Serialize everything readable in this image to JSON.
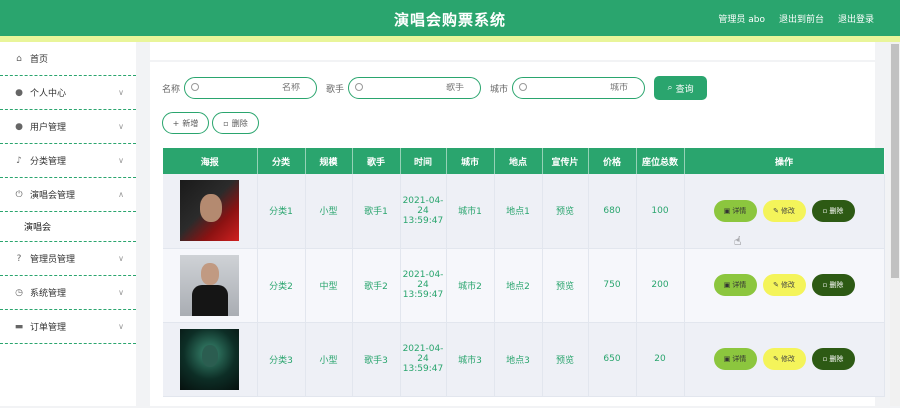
{
  "header": {
    "title": "演唱会购票系统",
    "admin_label": "管理员 abo",
    "to_front_label": "退出到前台",
    "logout_label": "退出登录"
  },
  "sidebar": {
    "items": [
      {
        "label": "首页",
        "icon": "home-icon"
      },
      {
        "label": "个人中心",
        "icon": "user-icon"
      },
      {
        "label": "用户管理",
        "icon": "pin-icon"
      },
      {
        "label": "分类管理",
        "icon": "bell-icon"
      },
      {
        "label": "演唱会管理",
        "icon": "power-icon"
      }
    ],
    "sub_item": "演唱会",
    "bottom_items": [
      {
        "label": "管理员管理",
        "icon": "help-icon"
      },
      {
        "label": "系统管理",
        "icon": "clock-icon"
      },
      {
        "label": "订单管理",
        "icon": "ticket-icon"
      }
    ]
  },
  "search": {
    "name_label": "名称",
    "name_placeholder": "名称",
    "singer_label": "歌手",
    "singer_placeholder": "歌手",
    "city_label": "城市",
    "city_placeholder": "城市",
    "query_label": "查询"
  },
  "actions": {
    "add_label": "新增",
    "delete_label": "删除"
  },
  "table": {
    "headers": [
      "海报",
      "分类",
      "规模",
      "歌手",
      "时间",
      "城市",
      "地点",
      "宣传片",
      "价格",
      "座位总数",
      "操作"
    ],
    "rows": [
      {
        "category": "分类1",
        "size": "小型",
        "singer": "歌手1",
        "time": "2021-04-24 13:59:47",
        "city": "城市1",
        "place": "地点1",
        "promo": "预览",
        "price": "680",
        "seats": "100"
      },
      {
        "category": "分类2",
        "size": "中型",
        "singer": "歌手2",
        "time": "2021-04-24 13:59:47",
        "city": "城市2",
        "place": "地点2",
        "promo": "预览",
        "price": "750",
        "seats": "200"
      },
      {
        "category": "分类3",
        "size": "小型",
        "singer": "歌手3",
        "time": "2021-04-24 13:59:47",
        "city": "城市3",
        "place": "地点3",
        "promo": "预览",
        "price": "650",
        "seats": "20"
      }
    ],
    "op_labels": {
      "detail": "详情",
      "edit": "修改",
      "delete": "删除"
    }
  },
  "colors": {
    "primary": "#2aa56e",
    "stripe": "#e9f59a",
    "detail": "#8cc63e",
    "edit": "#f4f45a",
    "delete": "#2d5a14"
  }
}
